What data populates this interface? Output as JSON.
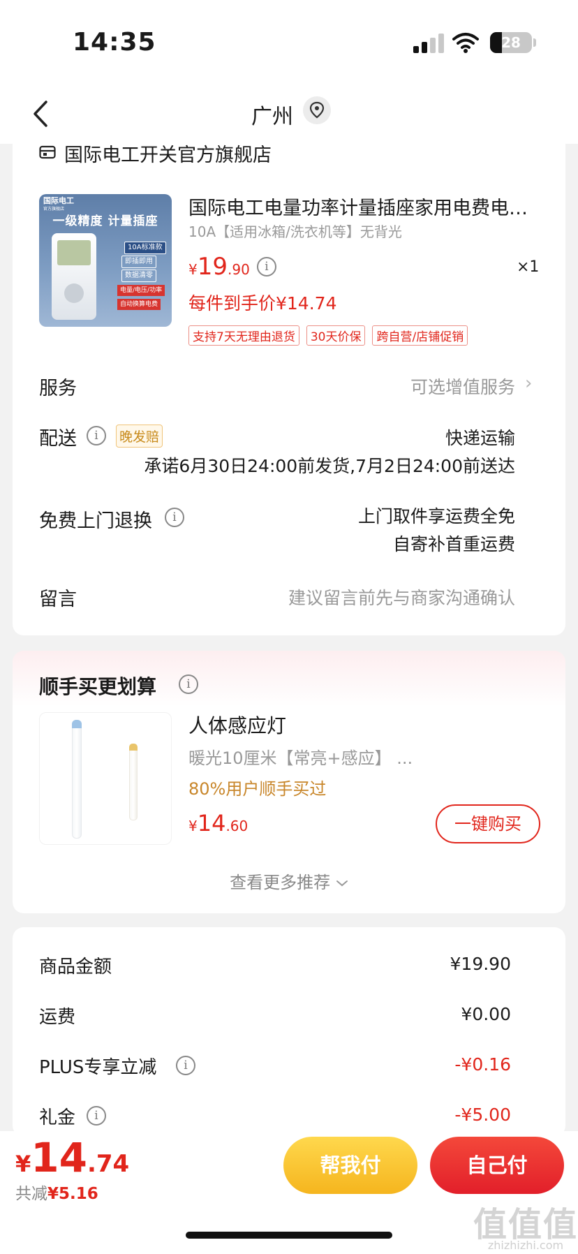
{
  "status_bar": {
    "time": "14:35",
    "battery": "28"
  },
  "nav": {
    "title": "广州"
  },
  "shop": {
    "name": "国际电工开关官方旗舰店"
  },
  "product": {
    "image_texts": {
      "brand": "国际电工",
      "brand_sub": "官方旗舰店",
      "headline": "一级精度 计量插座",
      "tags": [
        "10A标准款",
        "即插即用",
        "数据清零",
        "电量/电压/功率",
        "自动换算电费"
      ]
    },
    "title": "国际电工电量功率计量插座家用电费电…",
    "spec": "10A【适用冰箱/洗衣机等】无背光",
    "price_symbol": "¥",
    "price_int": "19",
    "price_dec": ".90",
    "quantity": "×1",
    "final_price": "每件到手价¥14.74",
    "badges": [
      "支持7天无理由退货",
      "30天价保",
      "跨自营/店铺促销"
    ]
  },
  "rows": {
    "service": {
      "label": "服务",
      "value": "可选增值服务"
    },
    "delivery": {
      "label": "配送",
      "badge": "晚发赔",
      "value": "快递运输",
      "promise": "承诺6月30日24:00前发货,7月2日24:00前送达"
    },
    "return": {
      "label": "免费上门退换",
      "line1": "上门取件享运费全免",
      "line2": "自寄补首重运费"
    },
    "message": {
      "label": "留言",
      "placeholder": "建议留言前先与商家沟通确认"
    }
  },
  "addon": {
    "title": "顺手买更划算",
    "item_title": "人体感应灯",
    "item_spec": "暖光10厘米【常亮+感应】 ...",
    "item_stat": "80%用户顺手买过",
    "price_symbol": "¥",
    "price_int": "14",
    "price_dec": ".60",
    "buy_label": "一键购买",
    "more_label": "查看更多推荐"
  },
  "summary": {
    "items": [
      {
        "label": "商品金额",
        "value": "¥19.90"
      },
      {
        "label": "运费",
        "value": "¥0.00"
      },
      {
        "label": "PLUS专享立减",
        "value": "-¥0.16"
      },
      {
        "label": "礼金",
        "value": "-¥5.00"
      }
    ]
  },
  "bottom": {
    "price_symbol": "¥",
    "price_int": "14",
    "price_dec": ".74",
    "discount_label": "共减",
    "discount_value": "¥5.16",
    "help_pay": "帮我付",
    "self_pay": "自己付"
  },
  "watermark": {
    "glyphs": "值值值",
    "site": "zhizhizhi.com"
  },
  "colors": {
    "accent": "#e1251b",
    "help_pay": "#f5b51e",
    "badge_gold": "#c88a1a"
  }
}
